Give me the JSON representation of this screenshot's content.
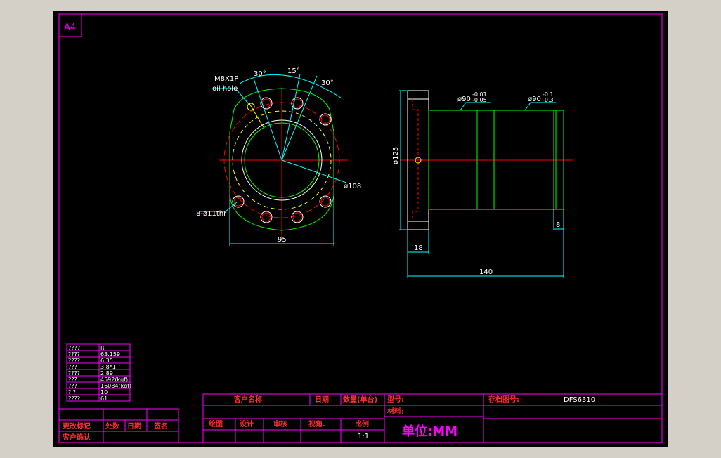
{
  "sheet_size": "A4",
  "front_view": {
    "callout_thread": "M8X1P",
    "callout_oil": "oil hole",
    "angle_1": "30°",
    "angle_2": "15°",
    "angle_3": "30°",
    "dia_pcd": "ø108",
    "holes": "8-ø11thr",
    "width": "95"
  },
  "side_view": {
    "dia_1": "ø90",
    "dia_1_tol_upper": "-0.01",
    "dia_1_tol_lower": "-0.05",
    "dia_2": "ø90",
    "dia_2_tol_upper": "-0.1",
    "dia_2_tol_lower": "-0.3",
    "flange_dia": "ø125",
    "flange_thk": "18",
    "length": "140",
    "end_len": "8"
  },
  "param_table": {
    "rows": [
      {
        "k": "????",
        "v": "R"
      },
      {
        "k": "????",
        "v": "63.159"
      },
      {
        "k": "????",
        "v": "6.35"
      },
      {
        "k": "???",
        "v": "3.8*1"
      },
      {
        "k": "????",
        "v": "2.89"
      },
      {
        "k": "???",
        "v": "4592(kgf)"
      },
      {
        "k": "???",
        "v": "16084(kgf)"
      },
      {
        "k": "?  ?",
        "v": "10"
      },
      {
        "k": "????",
        "v": "61"
      }
    ]
  },
  "revision_block": {
    "change_mark": "更改标记",
    "count": "处数",
    "date": "日期",
    "sign": "签名",
    "customer_confirm": "客户确认"
  },
  "title_block": {
    "customer_name": "客户名称",
    "date": "日期",
    "qty": "数量(单台)",
    "model": "型号:",
    "drawing_no_label": "存档图号:",
    "drawing_no": "DFS6310",
    "material": "材料:",
    "drawn": "绘图",
    "design": "设计",
    "check": "审核",
    "view": "视角.",
    "scale_label": "比例",
    "scale": "1:1",
    "unit": "单位:MM"
  }
}
